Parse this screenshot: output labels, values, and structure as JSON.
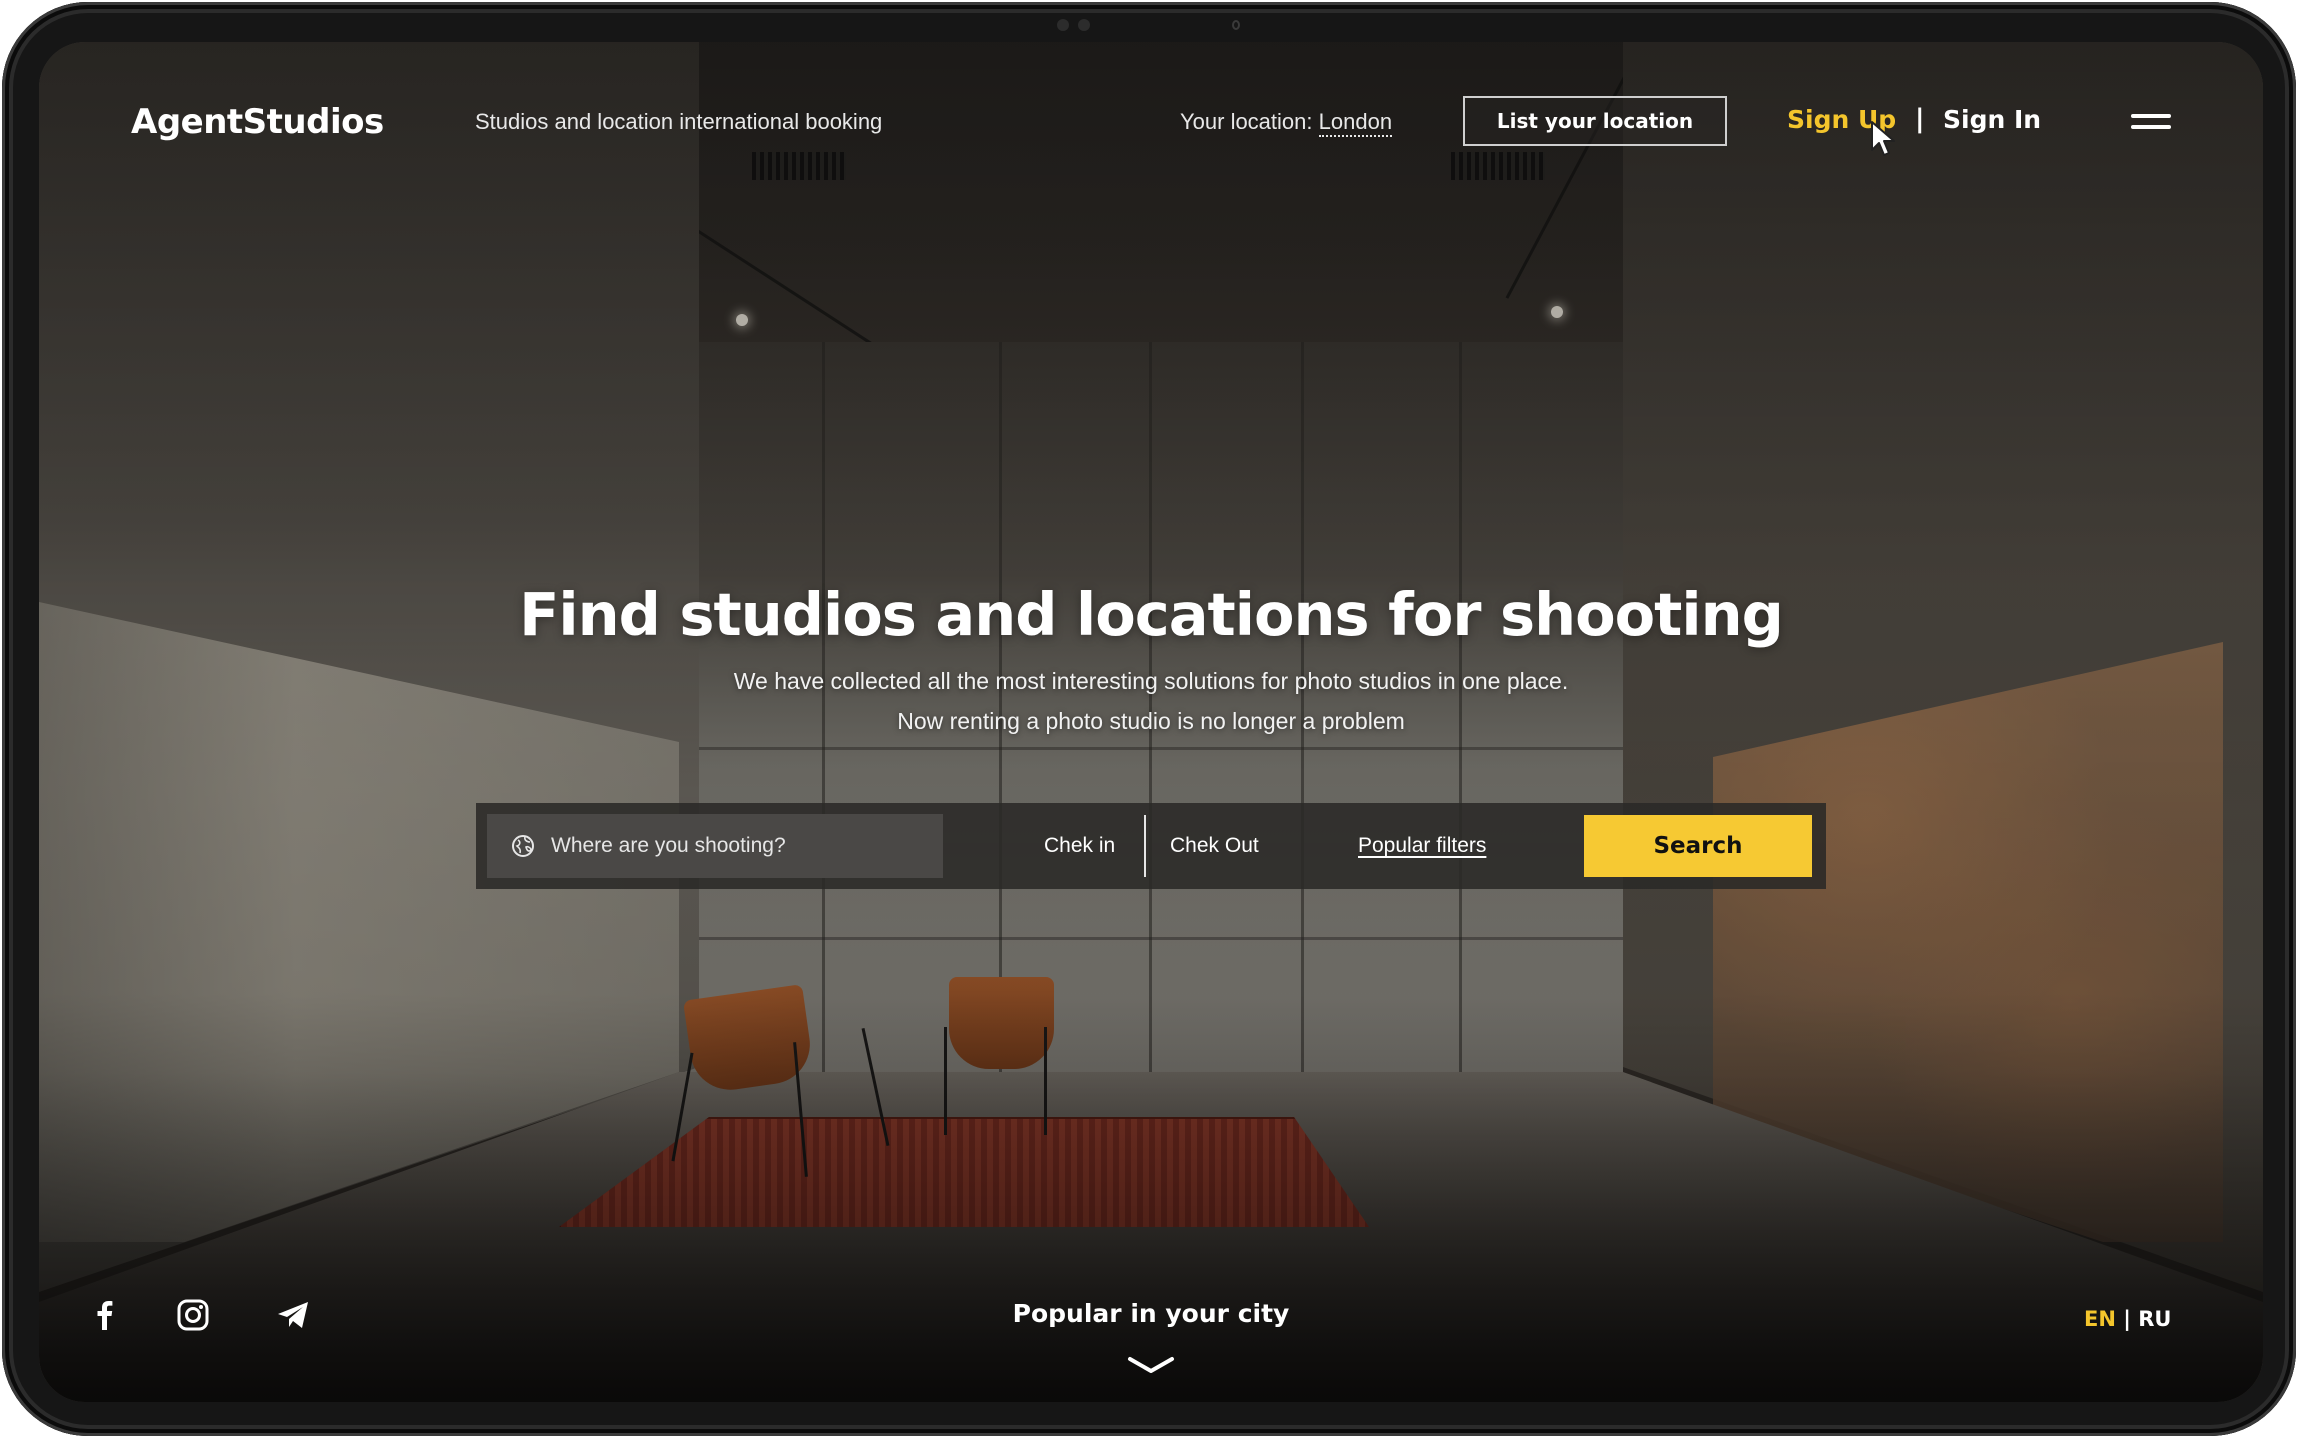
{
  "brand": {
    "logo": "AgentStudios",
    "tagline": "Studios and location international booking"
  },
  "header": {
    "location_label": "Your location:",
    "location_city": "London",
    "list_button": "List your location",
    "sign_up": "Sign Up",
    "separator": "|",
    "sign_in": "Sign In",
    "menu_icon": "hamburger-menu-icon"
  },
  "hero": {
    "title": "Find studios and locations for shooting",
    "subtitle_line1": "We have collected all the most interesting solutions for photo studios in one place.",
    "subtitle_line2": "Now renting a photo studio is no longer a problem"
  },
  "search": {
    "where_placeholder": "Where are you shooting?",
    "where_icon": "globe-icon",
    "check_in": "Chek in",
    "check_out": "Chek Out",
    "popular_filters": "Popular filters",
    "button": "Search"
  },
  "footer": {
    "social": [
      "facebook-icon",
      "instagram-icon",
      "telegram-icon"
    ],
    "popular_label": "Popular in your city",
    "scroll_icon": "chevron-down-icon",
    "lang_en": "EN",
    "lang_sep": "|",
    "lang_ru": "RU"
  },
  "colors": {
    "accent": "#f6c933",
    "text": "#ffffff",
    "search_bar": "#2a2927"
  }
}
